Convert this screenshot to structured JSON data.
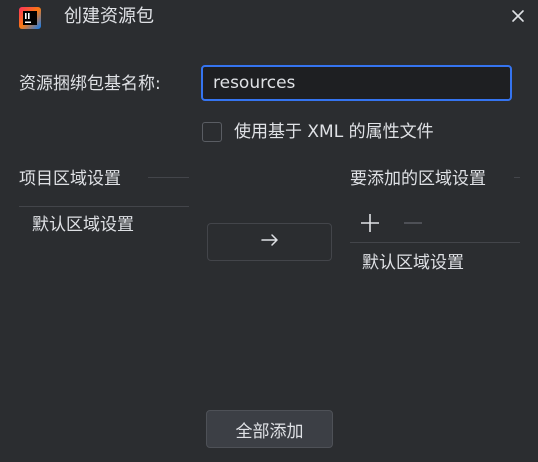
{
  "dialog": {
    "title": "创建资源包",
    "icons": {
      "app": "intellij-idea-logo-icon",
      "close": "close-icon"
    }
  },
  "form": {
    "base_name_label": "资源捆绑包基名称:",
    "base_name_value": "resources",
    "xml_checkbox_label": "使用基于 XML 的属性文件",
    "xml_checked": false
  },
  "project_locales": {
    "header": "项目区域设置",
    "items": [
      "默认区域设置"
    ]
  },
  "transfer": {
    "icon": "arrow-right-icon"
  },
  "selected_locales": {
    "header": "要添加的区域设置",
    "add_icon": "plus-icon",
    "remove_icon": "minus-icon",
    "items": [
      "默认区域设置"
    ]
  },
  "footer": {
    "add_all_label": "全部添加"
  },
  "colors": {
    "background": "#2b2d30",
    "input_background": "#1e1f22",
    "focus_accent": "#3574f0",
    "text": "#dfe1e5",
    "separator": "#43454a"
  }
}
